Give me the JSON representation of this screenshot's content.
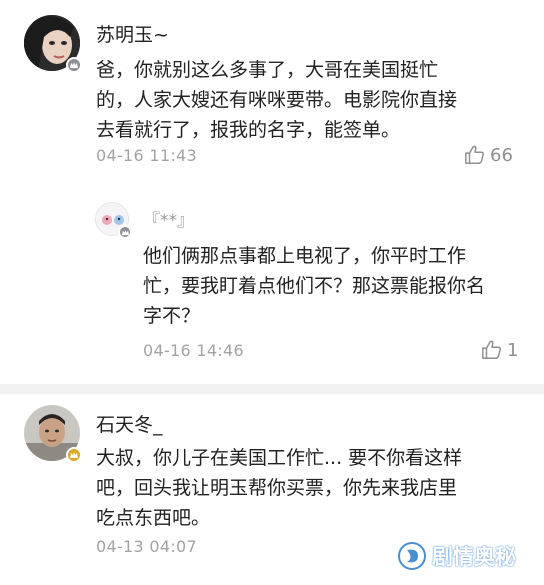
{
  "comments": [
    {
      "author": "苏明玉~",
      "lines": [
        "爸，你就别这么多事了，大哥在美国挺忙",
        "的，人家大嫂还有咪咪要带。电影院你直接",
        "去看就行了，报我的名字，能签单。"
      ],
      "time": "04-16 11:43",
      "likes": "66",
      "reply": {
        "author": "『**』",
        "lines": [
          "他们俩那点事都上电视了，你平时工作",
          "忙，要我盯着点他们不？那这票能报你名",
          "字不？"
        ],
        "time": "04-16 14:46",
        "likes": "1"
      }
    },
    {
      "author": "石天冬_",
      "lines": [
        "大叔，你儿子在美国工作忙... 要不你看这样",
        "吧，回头我让明玉帮你买票，你先来我店里",
        "吃点东西吧。"
      ],
      "time": "04-13 04:07"
    }
  ],
  "watermark": {
    "text": "剧情奥秘"
  },
  "icons": {
    "like": "thumbs-up-icon",
    "badge": "user-badge-icon"
  },
  "colors": {
    "text": "#222222",
    "muted": "#a3a3a3",
    "divider": "#f2f2f2",
    "badge_gray": "#8c8f96",
    "badge_gold": "#d9a72a"
  }
}
